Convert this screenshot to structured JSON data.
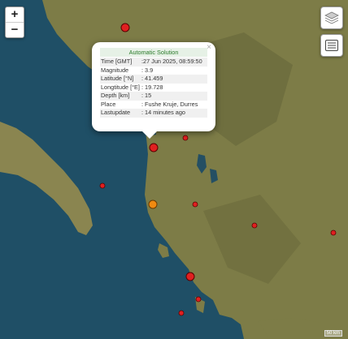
{
  "map": {
    "zoom_in_label": "+",
    "zoom_out_label": "−",
    "layers_icon": "layers-icon",
    "list_icon": "list-icon",
    "scale_label": "50 km"
  },
  "popup": {
    "title": "Automatic Solution",
    "close_label": "×",
    "rows": [
      {
        "key": "Time [GMT]",
        "value": ":27 Jun 2025, 08:59:50"
      },
      {
        "key": "Magnitude",
        "value": ": 3.9"
      },
      {
        "key": "Latitude [°N]",
        "value": ": 41.459"
      },
      {
        "key": "Longtitude [°E]",
        "value": ": 19.728"
      },
      {
        "key": "Depth [km]",
        "value": ": 15"
      },
      {
        "key": "Place",
        "value": ": Fushe Kruje, Durres"
      },
      {
        "key": "Lastupdate",
        "value": ": 14 minutes ago"
      }
    ]
  },
  "colors": {
    "sea": "#1f4f66",
    "land": "#7a7a45",
    "quake_red": "#e02020",
    "quake_orange": "#f08a10"
  }
}
